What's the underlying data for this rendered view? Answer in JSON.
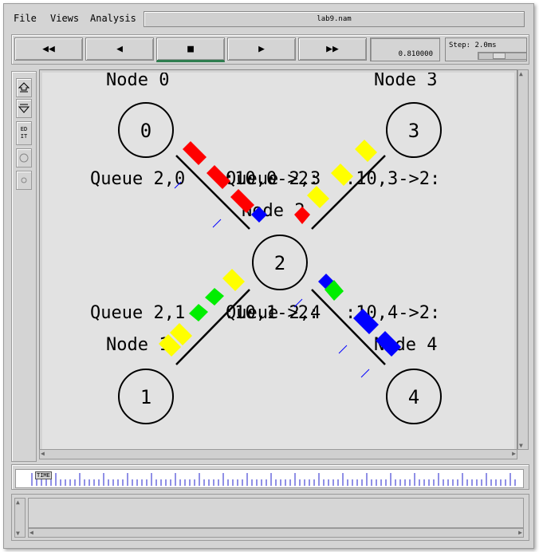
{
  "menu": {
    "file": "File",
    "views": "Views",
    "analysis": "Analysis"
  },
  "window_title": "lab9.nam",
  "toolbar": {
    "rewind": "◀◀",
    "back": "◀",
    "stop": "■",
    "play": "▶",
    "ffwd": "▶▶",
    "time": "0.810000",
    "step": "Step: 2.0ms"
  },
  "tools": {
    "edit": "ED\nIT"
  },
  "timeline": {
    "label": "TIME"
  },
  "network": {
    "nodes": [
      "0",
      "1",
      "2",
      "3",
      "4"
    ],
    "node_labels": [
      "Node 0",
      "Node 3",
      "Node 2",
      "Node 1",
      "Node 4"
    ],
    "queue_labels": [
      "Queue 2,0",
      "Queue 2,3",
      ":10,0->2:",
      ":10,3->2:",
      "Queue 2,1",
      "Queue 2,4",
      ":10,1->2:",
      ":10,4->2:"
    ]
  },
  "colors": {
    "red_flow": "#ff0000",
    "yellow_flow": "#ffff00",
    "green_flow": "#00ee00",
    "blue_flow": "#0000ff",
    "canvas_bg": "#e2e2e2"
  }
}
